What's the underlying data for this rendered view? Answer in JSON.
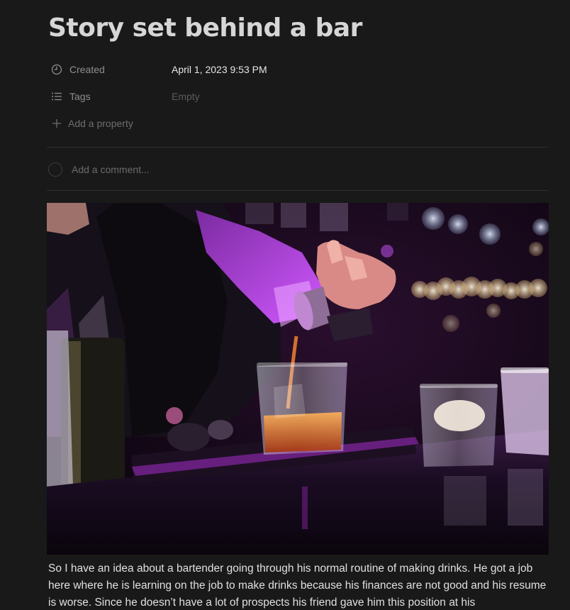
{
  "page": {
    "title": "Story set behind a bar"
  },
  "properties": [
    {
      "icon": "clock-icon",
      "label": "Created",
      "value": "April 1, 2023 9:53 PM",
      "empty": false
    },
    {
      "icon": "list-icon",
      "label": "Tags",
      "value": "Empty",
      "empty": true
    }
  ],
  "add_property": {
    "icon": "plus-icon",
    "label": "Add a property"
  },
  "comments": {
    "placeholder": "Add a comment..."
  },
  "cover": {
    "alt": "Bartender pouring a drink into a glass at a bar with purple lighting"
  },
  "body": {
    "paragraph": "So I have an idea about a bartender going through his normal routine of making drinks. He got a job here where he is learning on the job to make drinks because his finances are not good and his resume is worse. Since he doesn’t have a lot of prospects his friend gave him this position at his"
  },
  "colors": {
    "background": "#191919",
    "text": "#d4d4d4",
    "muted": "#8f8f8f",
    "accent_purple": "#b22fd8"
  }
}
